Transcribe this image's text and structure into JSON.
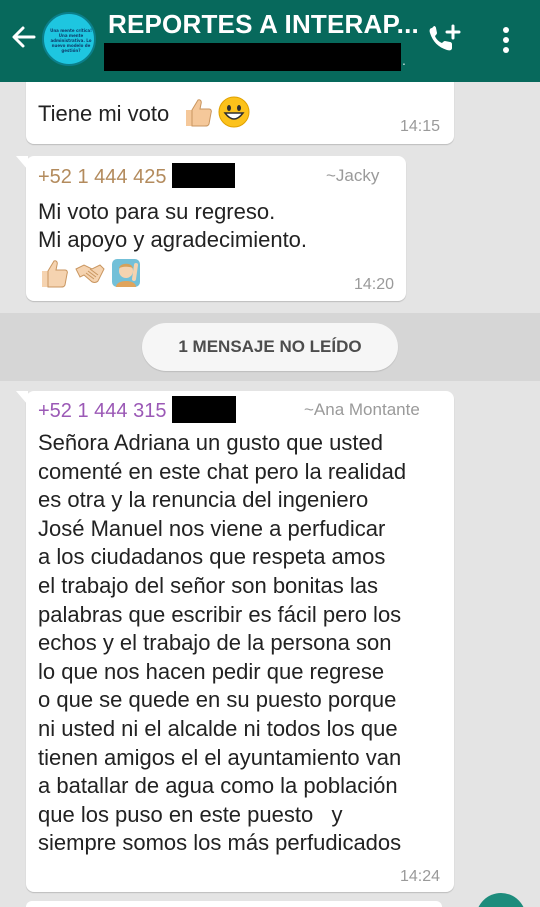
{
  "header": {
    "title": "REPORTES A INTERAP...",
    "subtitle_dot": ".",
    "avatar_text": "Una mente crítica! Una mente administrativa. Lo nuevo modelo de gestión?"
  },
  "messages": [
    {
      "text": "Tiene mi voto",
      "time": "14:15",
      "emoji": [
        "thumbs-up",
        "grinning-face"
      ]
    },
    {
      "sender_number": "+52 1 444 425",
      "sender_name": "~Jacky",
      "sender_color": "#b38b5d",
      "lines": [
        "Mi voto para su regreso.",
        "Mi apoyo y agradecimiento."
      ],
      "emoji": [
        "thumbs-up",
        "handshake",
        "person-raising-hand"
      ],
      "time": "14:20"
    },
    {
      "sender_number": "+52 1 444 315",
      "sender_name": "~Ana Montante",
      "sender_color": "#9b59b6",
      "lines": [
        "Señora Adriana un gusto que usted",
        "comenté en este chat pero la realidad",
        "es otra y la renuncia del ingeniero",
        "José Manuel nos viene a perfudicar",
        "a los ciudadanos que respeta amos",
        "el trabajo del señor son bonitas las",
        "palabras que escribir es fácil pero los",
        "echos y el trabajo de la persona son",
        "lo que nos hacen pedir que regrese",
        "o que se quede en su puesto porque",
        "ni usted ni el alcalde ni todos los que",
        "tienen amigos el el ayuntamiento van",
        "a batallar de agua como la población",
        "que los puso en este puesto   y",
        "siempre somos los más perfudicados"
      ],
      "time": "14:24"
    }
  ],
  "unread_label": "1 MENSAJE NO LEÍDO",
  "colors": {
    "header_bg": "#07695c",
    "chat_bg": "#e4e4e4"
  }
}
